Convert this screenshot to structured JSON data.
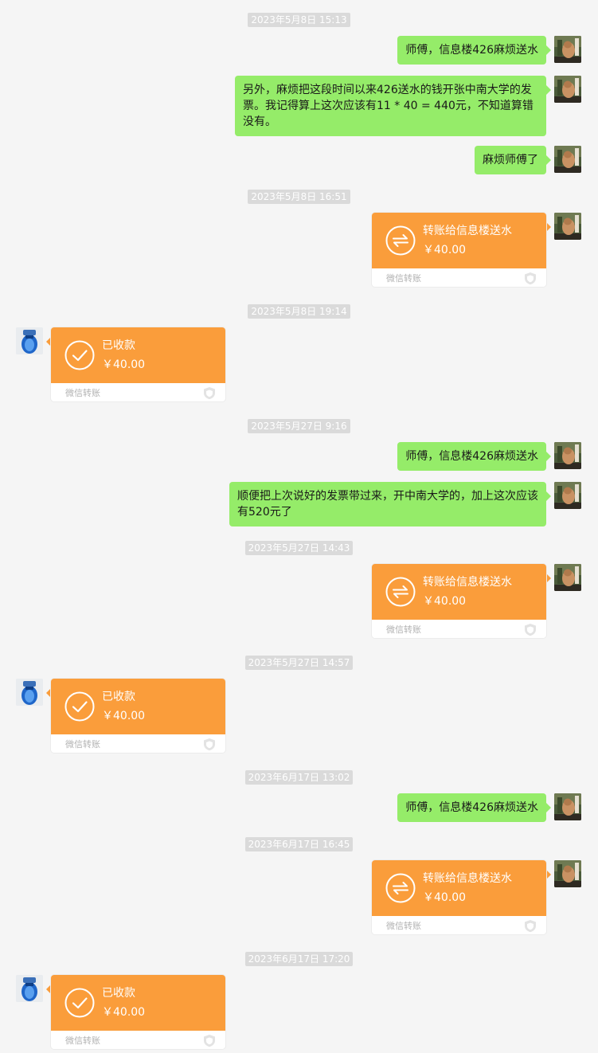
{
  "colors": {
    "background": "#f5f5f5",
    "my_bubble": "#95ec69",
    "transfer_card": "#fa9d3b",
    "timestamp_bg": "#dadada"
  },
  "timestamps": [
    "2023年5月8日 15:13",
    "2023年5月8日 16:51",
    "2023年5月8日 19:14",
    "2023年5月27日 9:16",
    "2023年5月27日 14:43",
    "2023年5月27日 14:57",
    "2023年6月17日 13:02",
    "2023年6月17日 16:45",
    "2023年6月17日 17:20"
  ],
  "messages": [
    "师傅，信息楼426麻烦送水",
    "另外，麻烦把这段时间以来426送水的钱开张中南大学的发票。我记得算上这次应该有11 * 40 = 440元，不知道算错没有。",
    "麻烦师傅了",
    "师傅，信息楼426麻烦送水",
    "顺便把上次说好的发票带过来，开中南大学的，加上这次应该有520元了",
    "师傅，信息楼426麻烦送水"
  ],
  "transfers": [
    {
      "title": "转账给信息楼送水",
      "amount": "￥40.00",
      "footer": "微信转账",
      "icon": "transfer-icon"
    },
    {
      "title": "已收款",
      "amount": "￥40.00",
      "footer": "微信转账",
      "icon": "check-icon"
    },
    {
      "title": "转账给信息楼送水",
      "amount": "￥40.00",
      "footer": "微信转账",
      "icon": "transfer-icon"
    },
    {
      "title": "已收款",
      "amount": "￥40.00",
      "footer": "微信转账",
      "icon": "check-icon"
    },
    {
      "title": "转账给信息楼送水",
      "amount": "￥40.00",
      "footer": "微信转账",
      "icon": "transfer-icon"
    },
    {
      "title": "已收款",
      "amount": "￥40.00",
      "footer": "微信转账",
      "icon": "check-icon"
    }
  ]
}
